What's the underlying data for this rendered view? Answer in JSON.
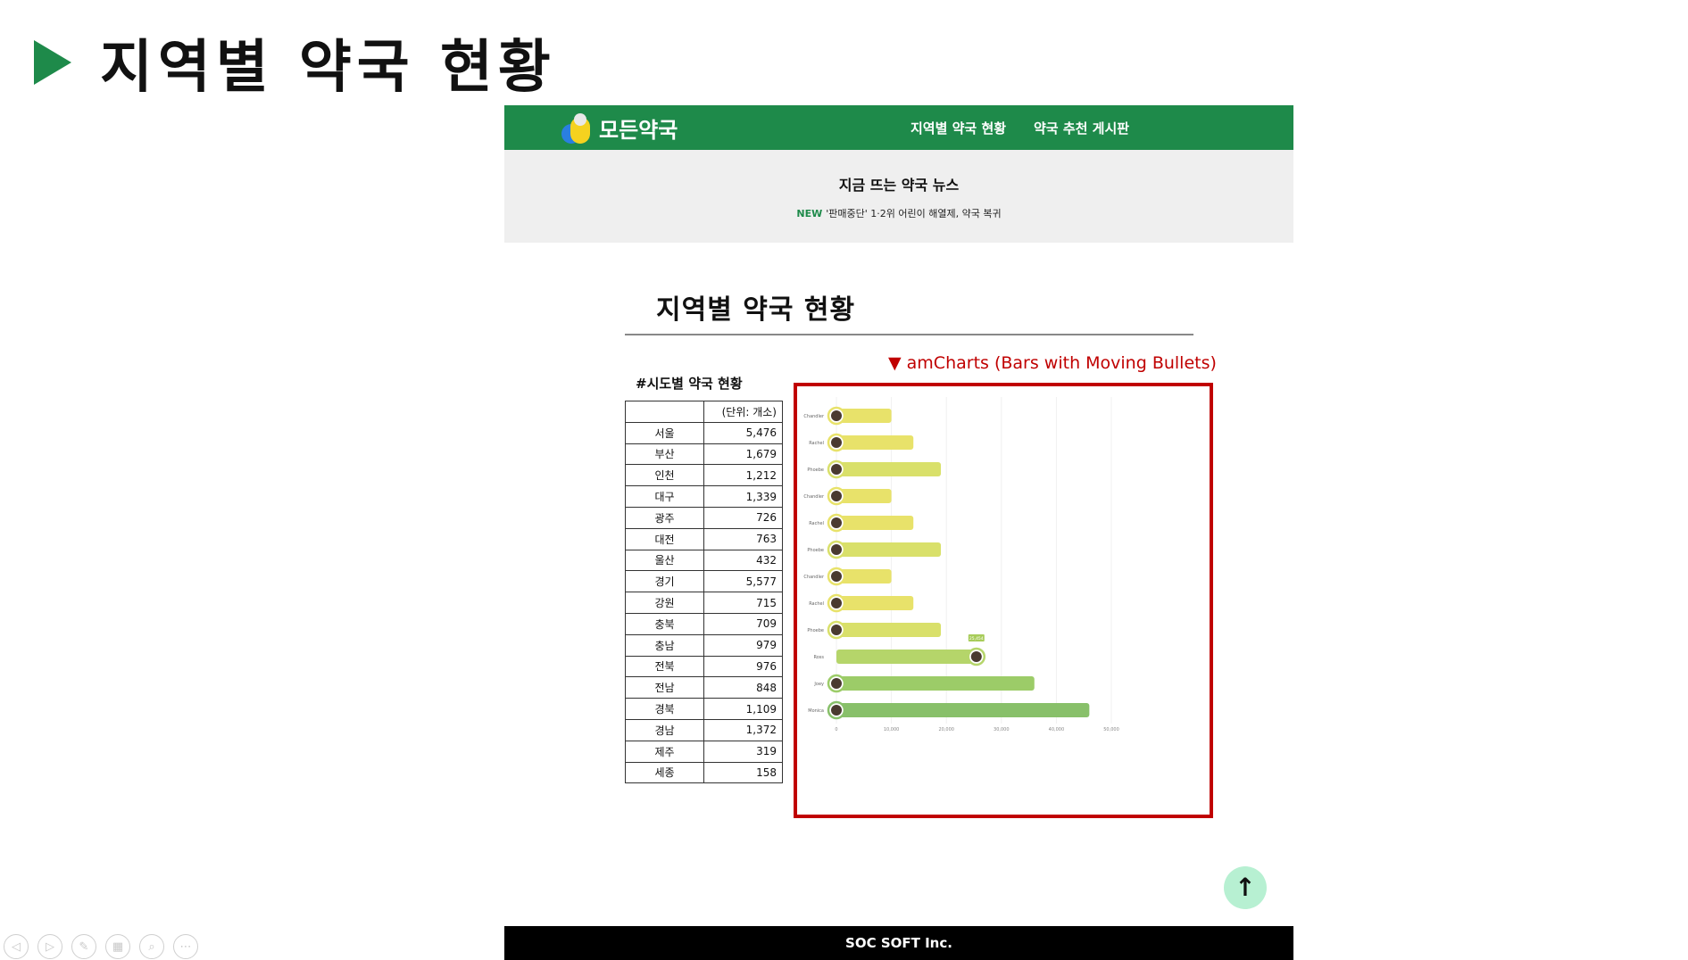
{
  "slide": {
    "title": "지역별 약국 현황"
  },
  "navbar": {
    "logo_text": "모든약국",
    "links": [
      "지역별 약국 현황",
      "약국 추천 게시판"
    ]
  },
  "news": {
    "title": "지금 뜨는 약국 뉴스",
    "badge": "NEW",
    "headline": "'판매중단' 1·2위 어린이 해열제, 약국 복귀"
  },
  "section": {
    "title": "지역별 약국 현황",
    "amcharts_note": "▼ amCharts (Bars with Moving Bullets)"
  },
  "table": {
    "caption": "#시도별 약국 현황",
    "unit_label": "(단위: 개소)",
    "rows": [
      {
        "region": "서울",
        "count": "5,476"
      },
      {
        "region": "부산",
        "count": "1,679"
      },
      {
        "region": "인천",
        "count": "1,212"
      },
      {
        "region": "대구",
        "count": "1,339"
      },
      {
        "region": "광주",
        "count": "726"
      },
      {
        "region": "대전",
        "count": "763"
      },
      {
        "region": "울산",
        "count": "432"
      },
      {
        "region": "경기",
        "count": "5,577"
      },
      {
        "region": "강원",
        "count": "715"
      },
      {
        "region": "충북",
        "count": "709"
      },
      {
        "region": "충남",
        "count": "979"
      },
      {
        "region": "전북",
        "count": "976"
      },
      {
        "region": "전남",
        "count": "848"
      },
      {
        "region": "경북",
        "count": "1,109"
      },
      {
        "region": "경남",
        "count": "1,372"
      },
      {
        "region": "제주",
        "count": "319"
      },
      {
        "region": "세종",
        "count": "158"
      }
    ]
  },
  "chart_data": {
    "type": "bar",
    "orientation": "horizontal",
    "title": "",
    "xlabel": "",
    "ylabel": "",
    "categories": [
      "Chandler",
      "Rachel",
      "Phoebe",
      "Chandler",
      "Rachel",
      "Phoebe",
      "Chandler",
      "Rachel",
      "Phoebe",
      "Ross",
      "Joey",
      "Monica"
    ],
    "values": [
      10000,
      14000,
      19000,
      10000,
      14000,
      19000,
      10000,
      14000,
      19000,
      25454,
      36000,
      46000
    ],
    "bar_colors": [
      "#e8e26a",
      "#e8e26a",
      "#d9e06a",
      "#e8e26a",
      "#e8e26a",
      "#d9e06a",
      "#e8e26a",
      "#e8e26a",
      "#d9e06a",
      "#b5d56a",
      "#9ccc68",
      "#88c06a"
    ],
    "xticks": [
      "0",
      "10,000",
      "20,000",
      "30,000",
      "40,000",
      "50,000"
    ],
    "xlim": [
      0,
      50000
    ],
    "tooltip_label": "25,454",
    "grid": true
  },
  "controls": {
    "icons": [
      "prev-icon",
      "next-icon",
      "pen-icon",
      "slides-icon",
      "zoom-icon",
      "more-icon"
    ]
  },
  "scroll_top": {
    "symbol": "↑"
  },
  "footer": {
    "text": "SOC SOFT Inc."
  }
}
